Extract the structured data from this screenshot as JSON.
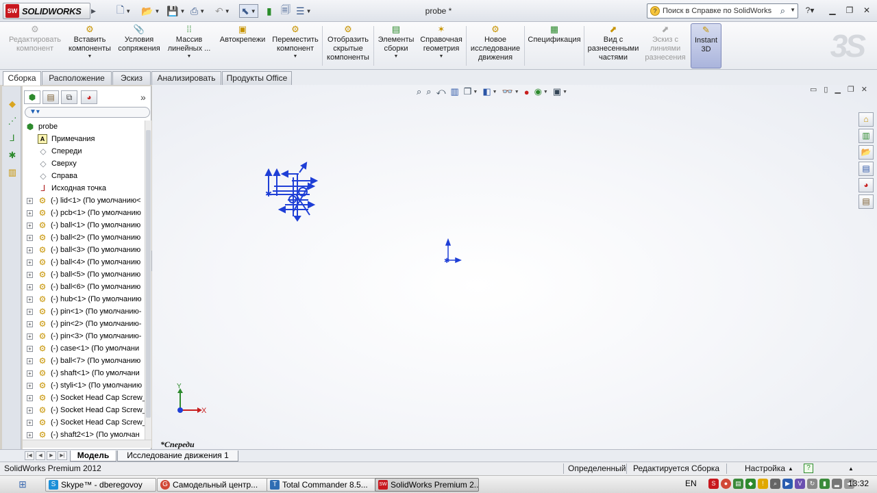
{
  "app": {
    "brand": "SOLIDWORKS",
    "brand_mark": "SW",
    "document_title": "probe *"
  },
  "help_search": {
    "placeholder": "Поиск в Справке по SolidWorks"
  },
  "commands": [
    {
      "label": "Редактировать компонент",
      "enabled": false
    },
    {
      "label": "Вставить компоненты",
      "enabled": true
    },
    {
      "label": "Условия сопряжения",
      "enabled": true
    },
    {
      "label": "Массив линейных ...",
      "enabled": true
    },
    {
      "label": "Автокрепежи",
      "enabled": true
    },
    {
      "label": "Переместить компонент",
      "enabled": true
    },
    {
      "label": "Отобразить скрытые компоненты",
      "enabled": true
    },
    {
      "label": "Элементы сборки",
      "enabled": true
    },
    {
      "label": "Справочная геометрия",
      "enabled": true
    },
    {
      "label": "Новое исследование движения",
      "enabled": true
    },
    {
      "label": "Спецификация",
      "enabled": true
    },
    {
      "label": "Вид с разнесенными частями",
      "enabled": true
    },
    {
      "label": "Эскиз с линиями разнесения",
      "enabled": false
    },
    {
      "label": "Instant 3D",
      "enabled": true,
      "active": true
    }
  ],
  "tabs": [
    "Сборка",
    "Расположение",
    "Эскиз",
    "Анализировать",
    "Продукты Office"
  ],
  "active_tab": "Сборка",
  "tree": {
    "root": "probe",
    "fixed_items": [
      "Примечания",
      "Спереди",
      "Сверху",
      "Справа",
      "Исходная точка"
    ],
    "components": [
      "(-) lid<1> (По умолчанию<",
      "(-) pcb<1> (По умолчанию",
      "(-) ball<1> (По умолчанию",
      "(-) ball<2> (По умолчанию",
      "(-) ball<3> (По умолчанию",
      "(-) ball<4> (По умолчанию",
      "(-) ball<5> (По умолчанию",
      "(-) ball<6> (По умолчанию",
      "(-) hub<1> (По умолчанию",
      "(-) pin<1> (По умолчанию-",
      "(-) pin<2> (По умолчанию-",
      "(-) pin<3> (По умолчанию-",
      "(-) case<1> (По умолчани",
      "(-) ball<7> (По умолчанию",
      "(-) shaft<1> (По умолчани",
      "(-) styli<1> (По умолчанию",
      "(-) Socket Head Cap Screw_",
      "(-) Socket Head Cap Screw_",
      "(-) Socket Head Cap Screw_",
      "(-) shaft2<1> (По умолчан"
    ]
  },
  "graphics": {
    "view_label": "*Спереди",
    "triad_x": "X",
    "triad_y": "Y"
  },
  "bottom_tabs": [
    "Модель",
    "Исследование движения 1"
  ],
  "statusbar": {
    "product": "SolidWorks Premium 2012",
    "state": "Определенный",
    "mode": "Редактируется Сборка",
    "custom": "Настройка"
  },
  "taskbar": {
    "tasks": [
      {
        "label": "Skype™ - dberegovoy",
        "icon": "S",
        "color": "#1b8fd8",
        "active": false
      },
      {
        "label": "Самодельный центр...",
        "icon": "G",
        "color": "#d14836",
        "active": false
      },
      {
        "label": "Total Commander 8.5...",
        "icon": "T",
        "color": "#2f6db3",
        "active": false
      },
      {
        "label": "SolidWorks Premium 2...",
        "icon": "SW",
        "color": "#c8171e",
        "active": true
      }
    ],
    "lang": "EN",
    "time": "13:32"
  },
  "colors": {
    "accent": "#1f3fd6",
    "brand_red": "#c8171e"
  }
}
